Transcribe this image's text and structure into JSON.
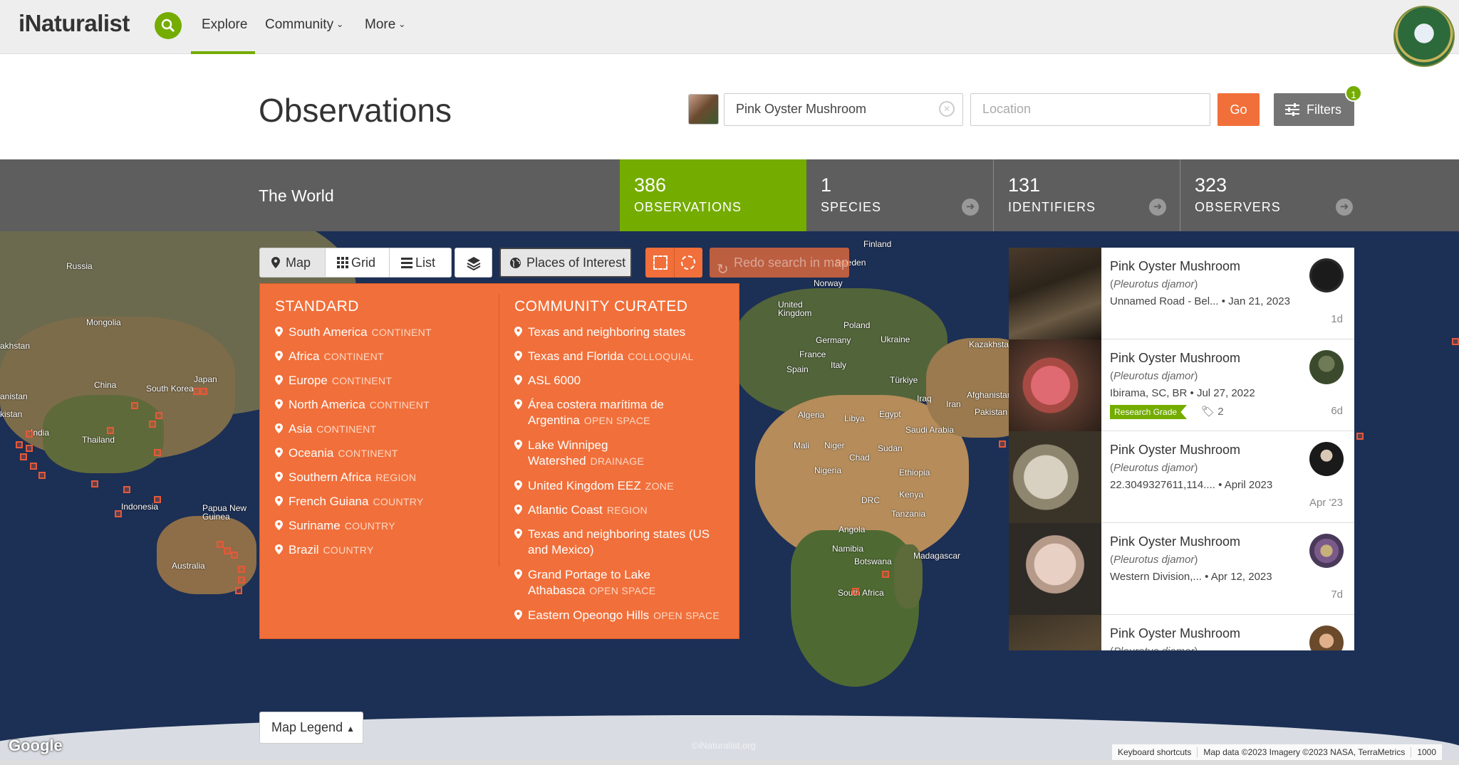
{
  "nav": {
    "logo_i": "i",
    "logo_rest": "Naturalist",
    "explore": "Explore",
    "community": "Community",
    "more": "More"
  },
  "header": {
    "title": "Observations",
    "taxon_value": "Pink Oyster Mushroom",
    "location_placeholder": "Location",
    "go_label": "Go",
    "filters_label": "Filters",
    "filters_count": "1"
  },
  "stats": {
    "place": "The World",
    "observations": {
      "num": "386",
      "label": "OBSERVATIONS"
    },
    "species": {
      "num": "1",
      "label": "SPECIES"
    },
    "identifiers": {
      "num": "131",
      "label": "IDENTIFIERS"
    },
    "observers": {
      "num": "323",
      "label": "OBSERVERS"
    }
  },
  "toolbar": {
    "map": "Map",
    "grid": "Grid",
    "list": "List",
    "poi": "Places of Interest",
    "redo": "Redo search in map"
  },
  "poi_panel": {
    "standard_heading": "STANDARD",
    "community_heading": "COMMUNITY CURATED",
    "standard": [
      {
        "name": "South America",
        "kind": "CONTINENT"
      },
      {
        "name": "Africa",
        "kind": "CONTINENT"
      },
      {
        "name": "Europe",
        "kind": "CONTINENT"
      },
      {
        "name": "North America",
        "kind": "CONTINENT"
      },
      {
        "name": "Asia",
        "kind": "CONTINENT"
      },
      {
        "name": "Oceania",
        "kind": "CONTINENT"
      },
      {
        "name": "Southern Africa",
        "kind": "REGION"
      },
      {
        "name": "French Guiana",
        "kind": "COUNTRY"
      },
      {
        "name": "Suriname",
        "kind": "COUNTRY"
      },
      {
        "name": "Brazil",
        "kind": "COUNTRY"
      }
    ],
    "community": [
      {
        "name": "Texas and neighboring states",
        "kind": ""
      },
      {
        "name": "Texas and Florida",
        "kind": "COLLOQUIAL"
      },
      {
        "name": "ASL 6000",
        "kind": ""
      },
      {
        "name": "Área costera marítima de",
        "name2": "Argentina",
        "kind": "OPEN SPACE"
      },
      {
        "name": "Lake Winnipeg",
        "name2": "Watershed",
        "kind": "DRAINAGE"
      },
      {
        "name": "United Kingdom EEZ",
        "kind": "ZONE"
      },
      {
        "name": "Atlantic Coast",
        "kind": "REGION"
      },
      {
        "name": "Texas and neighboring states (US",
        "name2": "and Mexico)",
        "kind": ""
      },
      {
        "name": "Grand Portage to Lake",
        "name2": "Athabasca",
        "kind": "OPEN SPACE"
      },
      {
        "name": "Eastern Opeongo Hills",
        "kind": "OPEN SPACE"
      }
    ]
  },
  "observations": [
    {
      "title": "Pink Oyster Mushroom",
      "sci": "Pleurotus djamor",
      "place": "Unnamed Road - Bel...",
      "date": "Jan 21, 2023",
      "time": "1d",
      "research_grade": ""
    },
    {
      "title": "Pink Oyster Mushroom",
      "sci": "Pleurotus djamor",
      "place": "Ibirama, SC, BR",
      "date": "Jul 27, 2022",
      "time": "6d",
      "research_grade": "Research Grade",
      "ids": "2"
    },
    {
      "title": "Pink Oyster Mushroom",
      "sci": "Pleurotus djamor",
      "place": "22.3049327611,114....",
      "date": "April 2023",
      "time": "Apr '23",
      "research_grade": ""
    },
    {
      "title": "Pink Oyster Mushroom",
      "sci": "Pleurotus djamor",
      "place": "Western Division,...",
      "date": "Apr 12, 2023",
      "time": "7d",
      "research_grade": ""
    },
    {
      "title": "Pink Oyster Mushroom",
      "sci": "Pleurotus djamor",
      "place": "",
      "date": "",
      "time": "",
      "research_grade": ""
    }
  ],
  "map": {
    "legend_label": "Map Legend",
    "google": "Google",
    "copyright": "©iNaturalist.org",
    "shortcuts": "Keyboard shortcuts",
    "attribution": "Map data ©2023 Imagery ©2023 NASA, TerraMetrics",
    "scale": "1000",
    "labels": [
      "Russia",
      "Mongolia",
      "China",
      "South Korea",
      "Japan",
      "India",
      "Thailand",
      "Indonesia",
      "Papua New Guinea",
      "Australia",
      "Finland",
      "Norway",
      "United Kingdom",
      "Poland",
      "Germany",
      "Ukraine",
      "France",
      "Spain",
      "Italy",
      "Türkiye",
      "Iraq",
      "Iran",
      "Algeria",
      "Libya",
      "Egypt",
      "Saudi Arabia",
      "Mali",
      "Niger",
      "Chad",
      "Sudan",
      "Nigeria",
      "Ethiopia",
      "DRC",
      "Kenya",
      "Tanzania",
      "Angola",
      "Namibia",
      "Botswana",
      "Madagascar",
      "South Africa",
      "Kazakhstan",
      "Afghanistan",
      "Pakistan",
      "Sweden",
      "akhstan",
      "kistan",
      "anistan"
    ]
  },
  "colors": {
    "brand_green": "#74ac00",
    "orange": "#f16f3a",
    "stats_gray": "#5e5e5e"
  }
}
